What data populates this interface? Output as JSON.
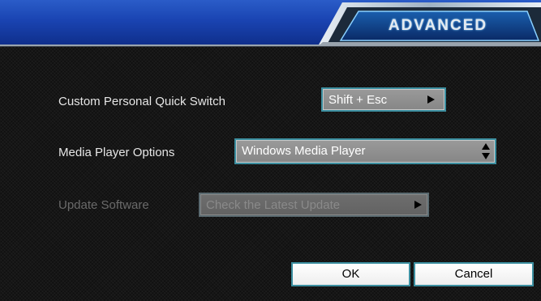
{
  "header": {
    "title": "ADVANCED"
  },
  "settings": {
    "quick_switch": {
      "label": "Custom Personal Quick Switch",
      "value": "Shift + Esc"
    },
    "media_player": {
      "label": "Media Player Options",
      "value": "Windows Media Player"
    },
    "update": {
      "label": "Update Software",
      "value": "Check the Latest Update",
      "enabled": false
    }
  },
  "buttons": {
    "ok": "OK",
    "cancel": "Cancel"
  },
  "colors": {
    "header_blue": "#1a44b2",
    "panel_bg": "#161616",
    "control_border": "#3c8fa0",
    "control_fill": "#8e8e8e",
    "label_text": "#e6e6e6",
    "disabled_text": "#6a6a6a"
  },
  "icons": {
    "arrow": "play-right-arrow-icon",
    "spinner": "up-down-arrows-icon"
  }
}
